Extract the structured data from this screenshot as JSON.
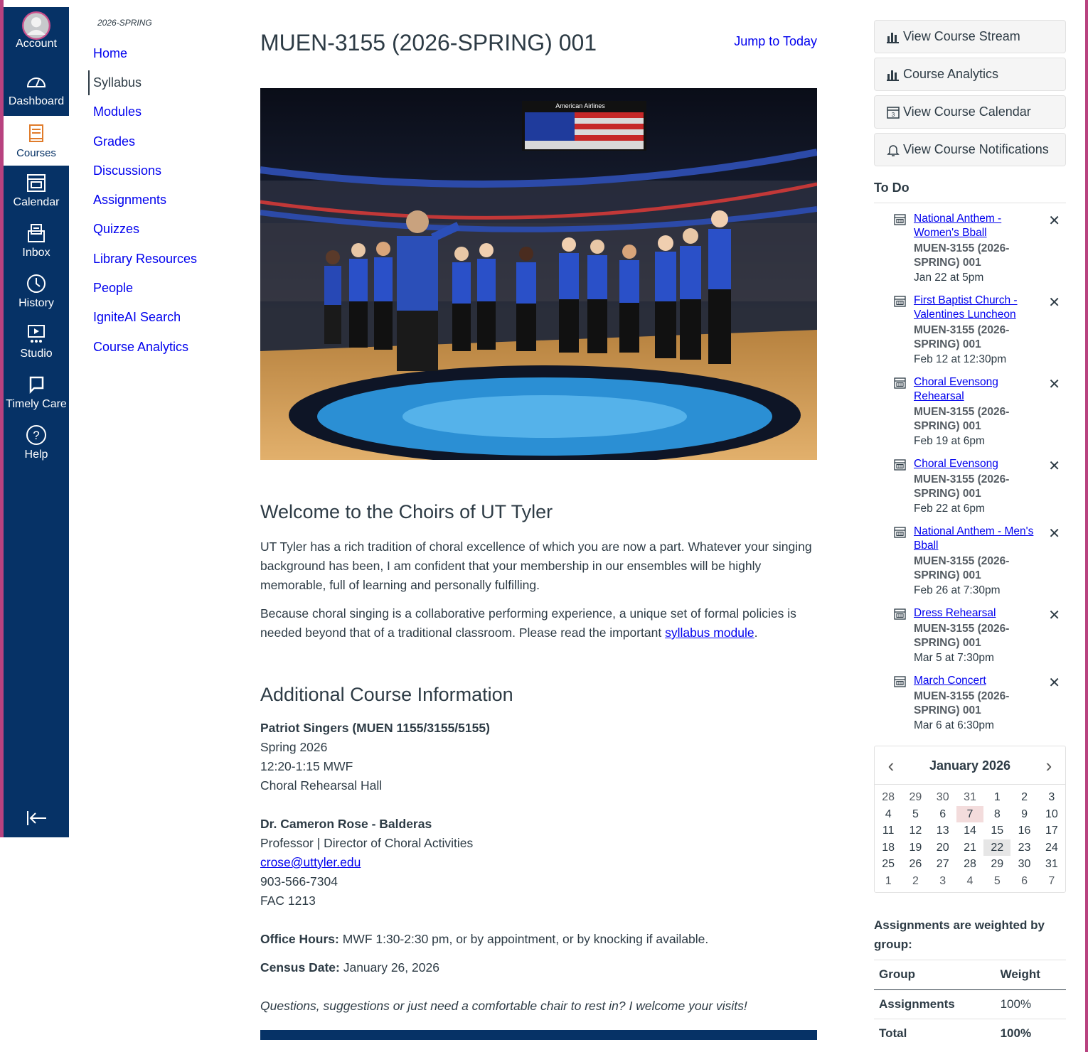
{
  "colors": {
    "nav_bg": "#063266",
    "accent_edge": "#b8427f",
    "link": "#0000ee",
    "text": "#2d3b45"
  },
  "global_nav": {
    "items": [
      {
        "label": "Account",
        "icon": "avatar-icon"
      },
      {
        "label": "Dashboard",
        "icon": "dashboard-icon"
      },
      {
        "label": "Courses",
        "icon": "courses-icon",
        "active": true
      },
      {
        "label": "Calendar",
        "icon": "calendar-icon"
      },
      {
        "label": "Inbox",
        "icon": "inbox-icon"
      },
      {
        "label": "History",
        "icon": "clock-icon"
      },
      {
        "label": "Studio",
        "icon": "studio-icon"
      },
      {
        "label": "Timely Care",
        "icon": "chat-icon"
      },
      {
        "label": "Help",
        "icon": "help-icon"
      }
    ]
  },
  "course_nav": {
    "term": "2026-SPRING",
    "items": [
      "Home",
      "Syllabus",
      "Modules",
      "Grades",
      "Discussions",
      "Assignments",
      "Quizzes",
      "Library Resources",
      "People",
      "IgniteAI Search",
      "Course Analytics"
    ],
    "active": "Syllabus"
  },
  "main": {
    "title": "MUEN-3155 (2026-SPRING) 001",
    "jump_today": "Jump to Today",
    "banner_text": "American Airlines",
    "welcome_heading": "Welcome to the Choirs of UT Tyler",
    "welcome_p1": "UT Tyler has a rich tradition of choral excellence of which you are now a part. Whatever your singing background has been, I am confident that your membership in our ensembles will be highly memorable, full of learning and personally fulfilling.",
    "welcome_p2_before": "Because choral singing is a collaborative performing experience, a unique set of formal policies is needed beyond that of a traditional classroom. Please read the important ",
    "welcome_p2_link": "syllabus module",
    "welcome_p2_after": ".",
    "additional_heading": "Additional Course Information",
    "course_name": "Patriot Singers (MUEN 1155/3155/5155)",
    "semester": "Spring 2026",
    "schedule": "12:20-1:15 MWF",
    "location": "Choral Rehearsal Hall",
    "instructor_name": "Dr. Cameron Rose - Balderas",
    "instructor_title": "Professor | Director of Choral Activities",
    "instructor_email": "crose@uttyler.edu",
    "instructor_phone": "903-566-7304",
    "instructor_office": "FAC 1213",
    "office_hours_label": "Office Hours:",
    "office_hours_value": " MWF 1:30-2:30 pm, or by appointment, or by knocking if available.",
    "census_label": "Census Date:",
    "census_value": " January 26, 2026",
    "closing": "Questions, suggestions or just need a comfortable chair to rest in? I welcome your visits!"
  },
  "sidebar": {
    "buttons": {
      "stream": "View Course Stream",
      "analytics": "Course Analytics",
      "calendar": "View Course Calendar",
      "notifications": "View Course Notifications"
    },
    "todo_header": "To Do",
    "todos": [
      {
        "title": "National Anthem - Women's Bball",
        "course": "MUEN-3155 (2026-SPRING) 001",
        "date": "Jan 22 at 5pm"
      },
      {
        "title": "First Baptist Church - Valentines Luncheon",
        "course": "MUEN-3155 (2026-SPRING) 001",
        "date": "Feb 12 at 12:30pm"
      },
      {
        "title": "Choral Evensong Rehearsal",
        "course": "MUEN-3155 (2026-SPRING) 001",
        "date": "Feb 19 at 6pm"
      },
      {
        "title": "Choral Evensong",
        "course": "MUEN-3155 (2026-SPRING) 001",
        "date": "Feb 22 at 6pm"
      },
      {
        "title": "National Anthem - Men's Bball",
        "course": "MUEN-3155 (2026-SPRING) 001",
        "date": "Feb 26 at 7:30pm"
      },
      {
        "title": "Dress Rehearsal",
        "course": "MUEN-3155 (2026-SPRING) 001",
        "date": "Mar 5 at 7:30pm"
      },
      {
        "title": "March Concert",
        "course": "MUEN-3155 (2026-SPRING) 001",
        "date": "Mar 6 at 6:30pm"
      }
    ],
    "calendar": {
      "month": "January 2026",
      "prev": "‹",
      "next": "›",
      "days": [
        "28",
        "29",
        "30",
        "31",
        "1",
        "2",
        "3",
        "4",
        "5",
        "6",
        "7",
        "8",
        "9",
        "10",
        "11",
        "12",
        "13",
        "14",
        "15",
        "16",
        "17",
        "18",
        "19",
        "20",
        "21",
        "22",
        "23",
        "24",
        "25",
        "26",
        "27",
        "28",
        "29",
        "30",
        "31",
        "1",
        "2",
        "3",
        "4",
        "5",
        "6",
        "7"
      ],
      "today": "7",
      "selected": "22"
    },
    "weights": {
      "title": "Assignments are weighted by group:",
      "col_group": "Group",
      "col_weight": "Weight",
      "rows": [
        {
          "group": "Assignments",
          "weight": "100%"
        },
        {
          "group": "Total",
          "weight": "100%"
        }
      ]
    }
  }
}
